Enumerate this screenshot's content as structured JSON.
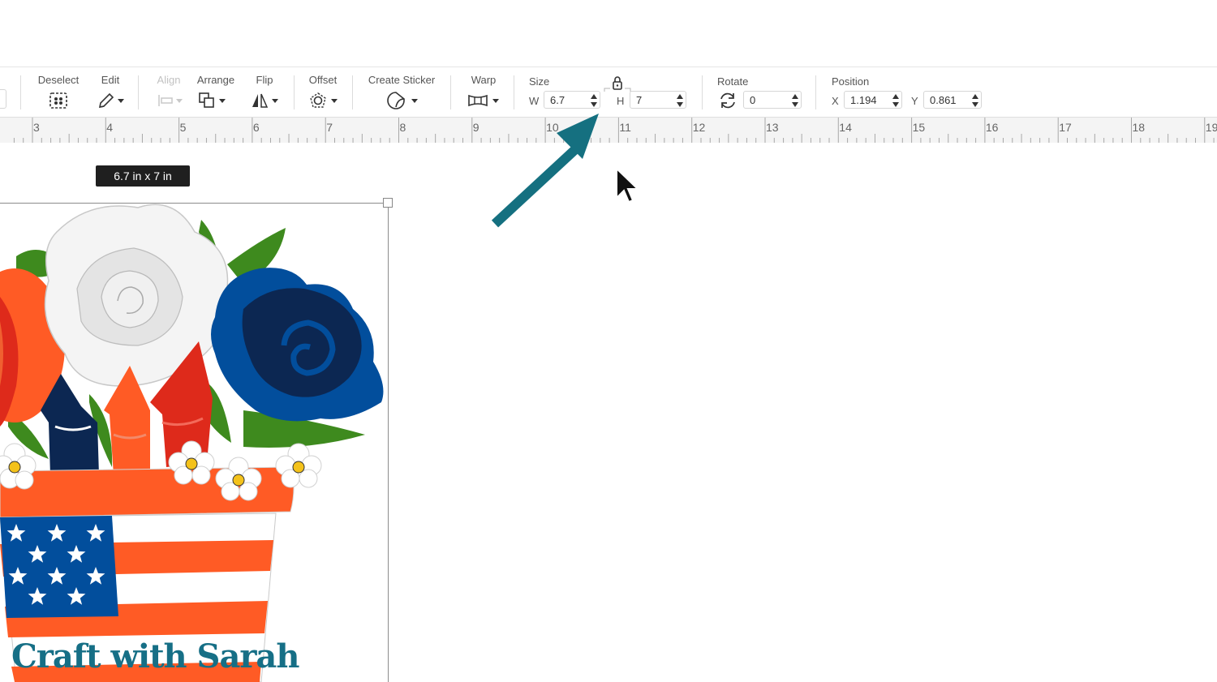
{
  "toolbar": {
    "deselect_label": "Deselect",
    "edit_label": "Edit",
    "align_label": "Align",
    "arrange_label": "Arrange",
    "flip_label": "Flip",
    "offset_label": "Offset",
    "create_sticker_label": "Create Sticker",
    "warp_label": "Warp",
    "size": {
      "label": "Size",
      "w_letter": "W",
      "w_value": "6.7",
      "h_letter": "H",
      "h_value": "7",
      "lock_icon": "lock-icon"
    },
    "rotate": {
      "label": "Rotate",
      "value": "0"
    },
    "position": {
      "label": "Position",
      "x_letter": "X",
      "x_value": "1.194",
      "y_letter": "Y",
      "y_value": "0.861"
    }
  },
  "ruler": {
    "numbers": [
      "3",
      "4",
      "5",
      "6",
      "7",
      "8",
      "9",
      "10",
      "11",
      "12",
      "13",
      "14",
      "15",
      "16",
      "17",
      "18",
      "19"
    ]
  },
  "canvas": {
    "size_badge": "6.7  in x 7  in",
    "watermark": "Craft with Sarah"
  },
  "colors": {
    "annotation_arrow": "#157080",
    "watermark": "#166f86",
    "orange": "#ff5b25",
    "red": "#de2a1b",
    "navy": "#0c2752",
    "blue": "#024e9c",
    "leaf": "#3e8a1e"
  },
  "icons": [
    "select-all-icon",
    "pencil-icon",
    "align-icon",
    "arrange-icon",
    "flip-icon",
    "offset-icon",
    "sticker-icon",
    "warp-icon",
    "lock-icon",
    "rotate-icon",
    "cursor-icon",
    "arrow-annotation-icon"
  ]
}
